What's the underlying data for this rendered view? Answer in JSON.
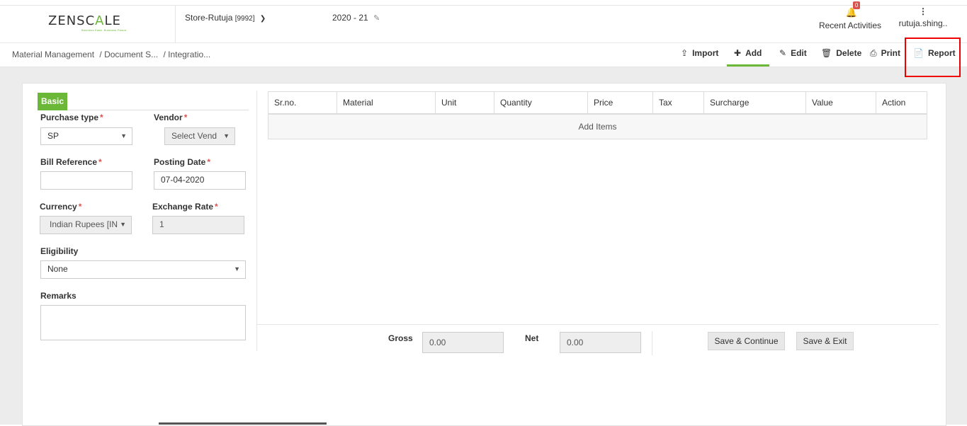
{
  "header": {
    "logo_text_dark": "ZENSC",
    "logo_text_mid": "A",
    "logo_text_end": "LE",
    "logo_tagline": "Business Ease. Business Peace.",
    "store": "Store-Rutuja",
    "store_code": "[9992]",
    "year": "2020 - 21",
    "notifications_count": "0",
    "recent_activities": "Recent Activities",
    "user": "rutuja.shing.."
  },
  "breadcrumb": [
    "Material Management",
    "/ Document S...",
    "/ Integratio..."
  ],
  "toolbar": {
    "import": "Import",
    "add": "Add",
    "edit": "Edit",
    "delete": "Delete",
    "print": "Print",
    "report": "Report"
  },
  "form": {
    "tab": "Basic",
    "purchase_type_label": "Purchase type",
    "purchase_type_value": "SP",
    "vendor_label": "Vendor",
    "vendor_value": "Select Vend",
    "bill_reference_label": "Bill Reference",
    "bill_reference_value": "",
    "posting_date_label": "Posting Date",
    "posting_date_value": "07-04-2020",
    "currency_label": "Currency",
    "currency_value": "Indian Rupees [IN",
    "exchange_rate_label": "Exchange Rate",
    "exchange_rate_value": "1",
    "eligibility_label": "Eligibility",
    "eligibility_value": "None",
    "remarks_label": "Remarks",
    "required_mark": "*"
  },
  "table": {
    "headers": [
      "Sr.no.",
      "Material",
      "Unit",
      "Quantity",
      "Price",
      "Tax",
      "Surcharge",
      "Value",
      "Action"
    ],
    "add_items": "Add Items"
  },
  "summary": {
    "gross_label": "Gross",
    "gross_value": "0.00",
    "net_label": "Net",
    "net_value": "0.00",
    "save_continue": "Save & Continue",
    "save_exit": "Save & Exit"
  },
  "colors": {
    "accent": "#6bb838",
    "required": "#d9534f",
    "highlight": "#ee0000"
  }
}
